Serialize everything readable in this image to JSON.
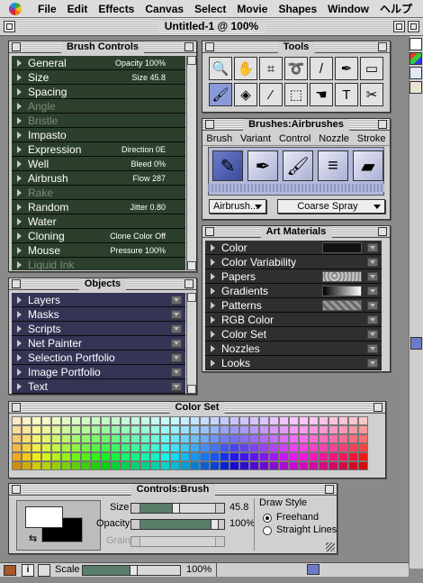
{
  "menubar": {
    "items": [
      "File",
      "Edit",
      "Effects",
      "Canvas",
      "Select",
      "Movie",
      "Shapes",
      "Window",
      "ヘルプ"
    ]
  },
  "document": {
    "title": "Untitled-1 @ 100%"
  },
  "brush_controls": {
    "title": "Brush Controls",
    "rows": [
      {
        "label": "General",
        "value": "Opacity 100%",
        "enabled": true
      },
      {
        "label": "Size",
        "value": "Size 45.8",
        "enabled": true
      },
      {
        "label": "Spacing",
        "value": "",
        "enabled": true
      },
      {
        "label": "Angle",
        "value": "",
        "enabled": false
      },
      {
        "label": "Bristle",
        "value": "",
        "enabled": false
      },
      {
        "label": "Impasto",
        "value": "",
        "enabled": true
      },
      {
        "label": "Expression",
        "value": "Direction 0E",
        "enabled": true
      },
      {
        "label": "Well",
        "value": "Bleed 0%",
        "enabled": true
      },
      {
        "label": "Airbrush",
        "value": "Flow 287",
        "enabled": true
      },
      {
        "label": "Rake",
        "value": "",
        "enabled": false
      },
      {
        "label": "Random",
        "value": "Jitter 0.80",
        "enabled": true
      },
      {
        "label": "Water",
        "value": "",
        "enabled": true
      },
      {
        "label": "Cloning",
        "value": "Clone Color Off",
        "enabled": true
      },
      {
        "label": "Mouse",
        "value": "Pressure 100%",
        "enabled": true
      },
      {
        "label": "Liquid Ink",
        "value": "",
        "enabled": false
      }
    ]
  },
  "objects": {
    "title": "Objects",
    "rows": [
      "Layers",
      "Masks",
      "Scripts",
      "Net Painter",
      "Selection Portfolio",
      "Image Portfolio",
      "Text"
    ]
  },
  "tools": {
    "title": "Tools",
    "items": [
      {
        "icon": "magnifier-icon",
        "glyph": "🔍",
        "selected": false
      },
      {
        "icon": "grabber-hand-icon",
        "glyph": "✋",
        "selected": false
      },
      {
        "icon": "crop-icon",
        "glyph": "⌗",
        "selected": false
      },
      {
        "icon": "lasso-icon",
        "glyph": "➰",
        "selected": false
      },
      {
        "icon": "magic-wand-icon",
        "glyph": "/",
        "selected": false
      },
      {
        "icon": "pen-icon",
        "glyph": "✒",
        "selected": false
      },
      {
        "icon": "rectangle-icon",
        "glyph": "▭",
        "selected": false
      },
      {
        "icon": "brush-icon",
        "glyph": "🖌",
        "selected": true
      },
      {
        "icon": "paint-bucket-icon",
        "glyph": "◈",
        "selected": false
      },
      {
        "icon": "dropper-icon",
        "glyph": "⁄",
        "selected": false
      },
      {
        "icon": "rect-select-icon",
        "glyph": "⬚",
        "selected": false
      },
      {
        "icon": "adjuster-icon",
        "glyph": "☚",
        "selected": false
      },
      {
        "icon": "text-icon",
        "glyph": "T",
        "selected": false
      },
      {
        "icon": "scissors-icon",
        "glyph": "✂",
        "selected": false
      }
    ]
  },
  "brushes": {
    "title": "Brushes:Airbrushes",
    "menu": [
      "Brush",
      "Variant",
      "Control",
      "Nozzle",
      "Stroke"
    ],
    "variants": [
      "airbrush-icon",
      "pen-nib-icon",
      "paintbrush-icon",
      "gradient-brush-icon",
      "marker-icon"
    ],
    "category_value": "Airbrush...",
    "variant_value": "Coarse Spray"
  },
  "art_materials": {
    "title": "Art Materials",
    "rows": [
      {
        "label": "Color",
        "swatch": "#111111"
      },
      {
        "label": "Color Variability",
        "swatch": ""
      },
      {
        "label": "Papers",
        "swatch": "paper"
      },
      {
        "label": "Gradients",
        "swatch": "gradient"
      },
      {
        "label": "Patterns",
        "swatch": "pattern"
      },
      {
        "label": "RGB Color",
        "swatch": ""
      },
      {
        "label": "Color Set",
        "swatch": ""
      },
      {
        "label": "Nozzles",
        "swatch": ""
      },
      {
        "label": "Looks",
        "swatch": ""
      }
    ]
  },
  "color_set": {
    "title": "Color Set"
  },
  "controls_brush": {
    "title": "Controls:Brush",
    "size_label": "Size",
    "size_value": "45.8",
    "size_fraction": 0.48,
    "opacity_label": "Opacity",
    "opacity_value": "100%",
    "opacity_fraction": 1.0,
    "grain_label": "Grain",
    "draw_style_label": "Draw Style",
    "freehand_label": "Freehand",
    "straight_label": "Straight Lines",
    "primary_color": "#ffffff",
    "secondary_color": "#000000"
  },
  "statusbar": {
    "scale_label": "Scale",
    "zoom_value": "100%"
  },
  "colors": {
    "selection": "#8a9ad8",
    "green_bg": "#2c3f2c",
    "purple_bg": "#343555"
  }
}
